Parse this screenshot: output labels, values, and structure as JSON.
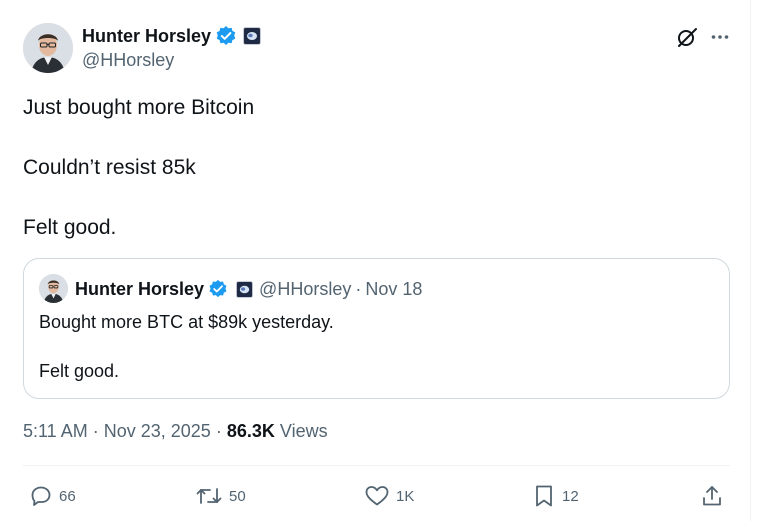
{
  "author": {
    "name": "Hunter Horsley",
    "handle": "@HHorsley"
  },
  "tweet": {
    "lines": [
      "Just bought more Bitcoin",
      "Couldn’t resist 85k",
      "Felt good."
    ],
    "time": "5:11 AM",
    "date": "Nov 23, 2025",
    "views_count": "86.3K",
    "views_label": "Views"
  },
  "quote": {
    "name": "Hunter Horsley",
    "handle": "@HHorsley",
    "date": "Nov 18",
    "lines": [
      "Bought more BTC at $89k yesterday.",
      "Felt good."
    ]
  },
  "actions": {
    "replies": "66",
    "reposts": "50",
    "likes": "1K",
    "bookmarks": "12"
  },
  "colors": {
    "text": "#0f1419",
    "secondary": "#536471",
    "verified": "#1d9bf0",
    "border": "#cfd9de"
  },
  "icons": [
    "grok-icon",
    "more-icon",
    "reply-icon",
    "repost-icon",
    "like-icon",
    "bookmark-icon",
    "share-icon",
    "verified-badge-icon",
    "affiliate-badge-icon"
  ]
}
